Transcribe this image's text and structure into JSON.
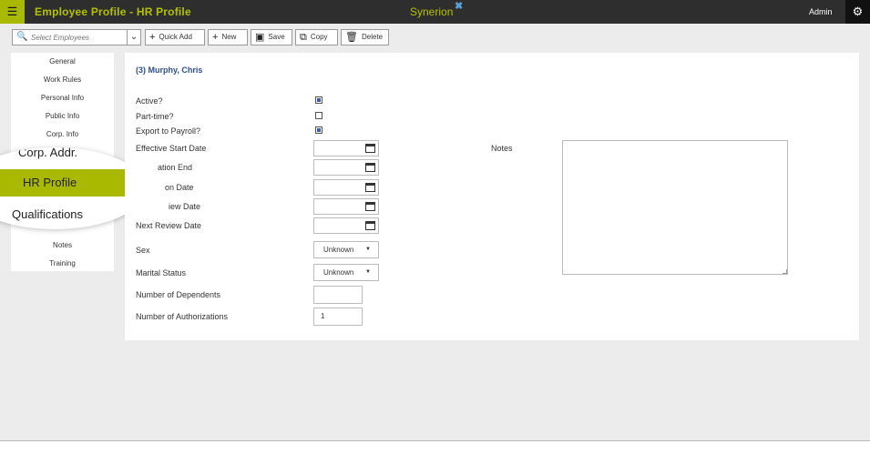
{
  "header": {
    "title": "Employee Profile - HR Profile",
    "logo_text": "Synerion",
    "logo_mark": "✖",
    "user": "Admin",
    "icons": {
      "menu": "hamburger-icon",
      "settings": "gear-icon"
    }
  },
  "toolbar": {
    "search_placeholder": "Select Employees",
    "quick_add": "Quick Add",
    "new": "New",
    "save": "Save",
    "copy": "Copy",
    "delete": "Delete"
  },
  "sidebar": {
    "items": [
      "General",
      "Work Rules",
      "Personal Info",
      "Public Info",
      "Corp. Info",
      "Notes",
      "Training"
    ],
    "zoom_items": [
      "Corp. Addr.",
      "HR Profile",
      "Qualifications"
    ],
    "active": "HR Profile"
  },
  "form": {
    "employee_name": "(3) Murphy, Chris",
    "active_label": "Active?",
    "active": true,
    "part_time_label": "Part-time?",
    "part_time": false,
    "export_label": "Export to Payroll?",
    "export": true,
    "effective_start_label": "Effective Start Date",
    "probation_end_label": "ation End",
    "probation_date_label": "on Date",
    "review_date_label": "iew Date",
    "next_review_label": "Next Review Date",
    "sex_label": "Sex",
    "sex_value": "Unknown",
    "marital_label": "Marital Status",
    "marital_value": "Unknown",
    "dependents_label": "Number of Dependents",
    "dependents_value": "",
    "authorizations_label": "Number of Authorizations",
    "authorizations_value": "1",
    "notes_label": "Notes",
    "notes_value": ""
  },
  "colors": {
    "accent": "#a9b800",
    "topbar": "#2e2e2e",
    "link": "#2d4f8f"
  }
}
